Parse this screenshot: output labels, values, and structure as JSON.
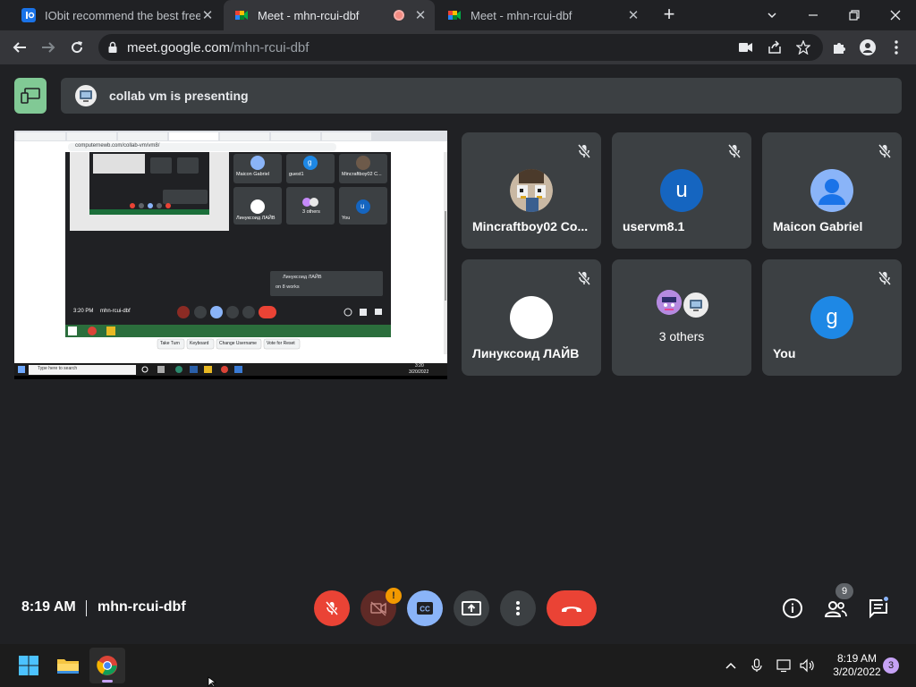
{
  "browser": {
    "tabs": [
      {
        "title": "IObit recommend the best free, f",
        "close": "✕"
      },
      {
        "title": "Meet - mhn-rcui-dbf",
        "close": "✕"
      },
      {
        "title": "Meet - mhn-rcui-dbf",
        "close": "✕"
      }
    ],
    "new_tab": "+",
    "url_host": "meet.google.com",
    "url_path": "/mhn-rcui-dbf"
  },
  "presenting_banner": "collab vm is presenting",
  "participants": [
    {
      "name": "Mincraftboy02 Co...",
      "avatar_letter": "",
      "avatar_color": "#6d5a4a"
    },
    {
      "name": "uservm8.1",
      "avatar_letter": "u",
      "avatar_color": "#1565c0"
    },
    {
      "name": "Maicon Gabriel",
      "avatar_letter": "",
      "avatar_color": "#8ab4f8"
    },
    {
      "name": "Линуксоид ЛАЙВ",
      "avatar_letter": "",
      "avatar_color": "#ffffff"
    },
    {
      "name": "3 others",
      "avatar_letter": "",
      "avatar_color": ""
    },
    {
      "name": "You",
      "avatar_letter": "g",
      "avatar_color": "#1e88e5"
    }
  ],
  "meeting": {
    "time": "8:19 AM",
    "code": "mhn-rcui-dbf",
    "people_count": "9",
    "camera_warning": "!"
  },
  "shared_screen": {
    "browser_url": "computernewb.com/collab-vm/vm8/",
    "tiles": [
      "Maicon Gabriel",
      "guest1",
      "Mincraftboy02 C...",
      "Линуксоид ЛАЙВ",
      "3 others",
      "You"
    ],
    "tile_letters": [
      "g",
      "u"
    ],
    "toast": "Линуксоид ЛАЙВ",
    "toast_sub": "on 8 works",
    "inner_time": "3:20 PM",
    "inner_code": "mhn-rcui-dbf",
    "vm_buttons": [
      "Take Turn",
      "Keyboard",
      "Change Username",
      "Vote for Reset"
    ],
    "search_placeholder": "Type here to search",
    "inner_clock_time": "3:20",
    "inner_clock_date": "3/20/2022"
  },
  "taskbar": {
    "time": "8:19 AM",
    "date": "3/20/2022",
    "notification_count": "3"
  },
  "colors": {
    "end_call": "#ea4335",
    "mic_off": "#ea4335",
    "camera_off": "#5f2a26",
    "captions": "#8ab4f8",
    "presenting_green": "#81c995"
  }
}
